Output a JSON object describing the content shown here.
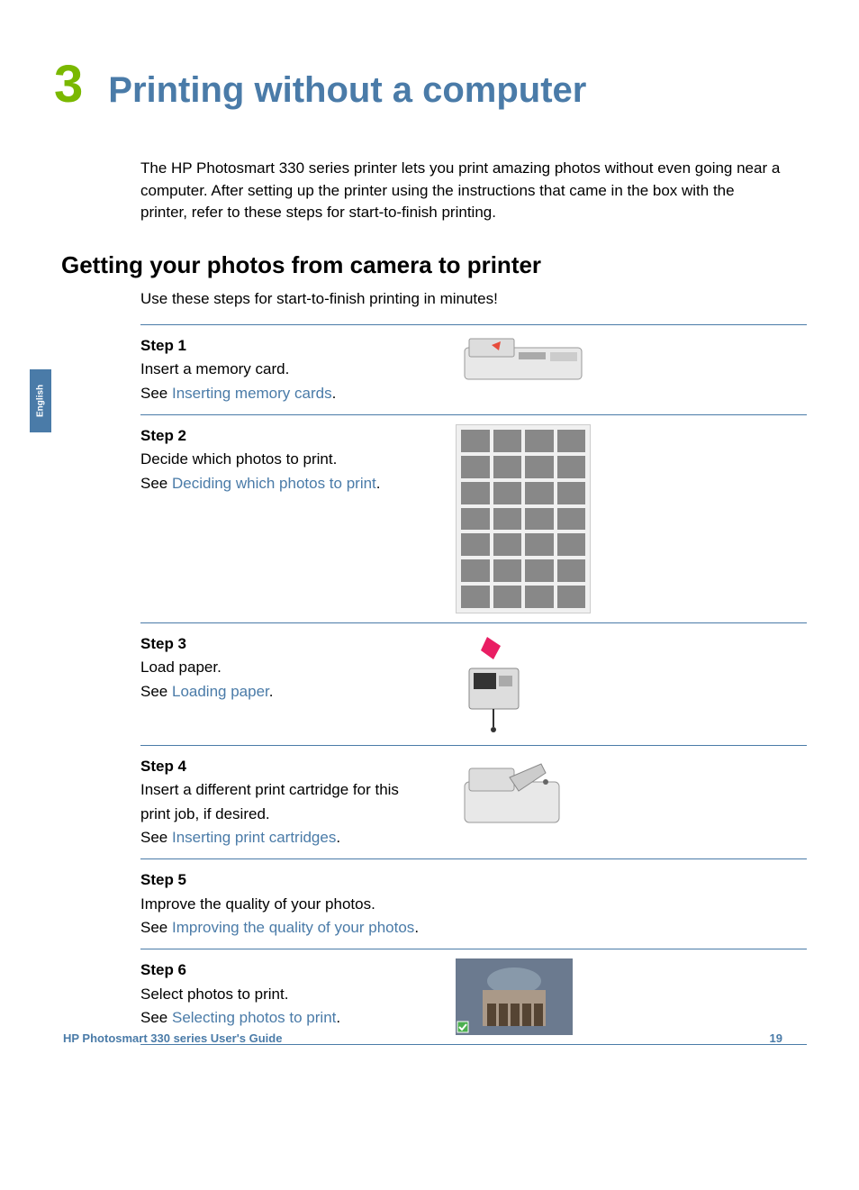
{
  "sideTab": "English",
  "chapter": {
    "number": "3",
    "title": "Printing without a computer"
  },
  "introText": "The HP Photosmart 330 series printer lets you print amazing photos without even going near a computer. After setting up the printer using the instructions that came in the box with the printer, refer to these steps for start-to-finish printing.",
  "section": {
    "title": "Getting your photos from camera to printer",
    "intro": "Use these steps for start-to-finish printing in minutes!"
  },
  "steps": [
    {
      "label": "Step 1",
      "desc": "Insert a memory card.",
      "seePrefix": "See ",
      "link": "Inserting memory cards",
      "period": "."
    },
    {
      "label": "Step 2",
      "desc": "Decide which photos to print.",
      "seePrefix": "See ",
      "link": "Deciding which photos to print",
      "period": "."
    },
    {
      "label": "Step 3",
      "desc": "Load paper.",
      "seePrefix": "See ",
      "link": "Loading paper",
      "period": "."
    },
    {
      "label": "Step 4",
      "desc": "Insert a different print cartridge for this print job, if desired.",
      "seePrefix": "See ",
      "link": "Inserting print cartridges",
      "period": "."
    },
    {
      "label": "Step 5",
      "desc": "Improve the quality of your photos.",
      "seePrefix": "See ",
      "link": "Improving the quality of your photos",
      "period": "."
    },
    {
      "label": "Step 6",
      "desc": "Select photos to print.",
      "seePrefix": "See ",
      "link": "Selecting photos to print",
      "period": "."
    }
  ],
  "footer": {
    "left": "HP Photosmart 330 series User's Guide",
    "right": "19"
  }
}
